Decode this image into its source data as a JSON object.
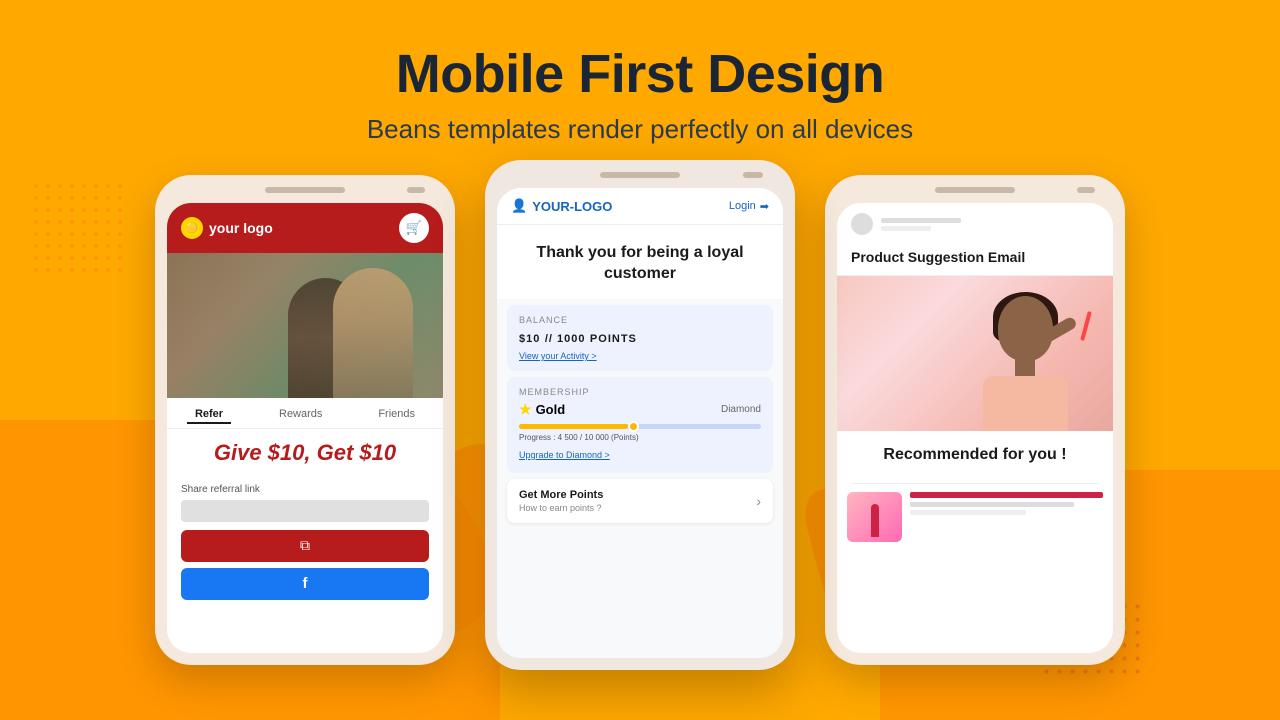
{
  "header": {
    "title": "Mobile First Design",
    "subtitle": "Beans templates render perfectly on all devices"
  },
  "phone1": {
    "logo_text": "your logo",
    "tabs": [
      "Refer",
      "Rewards",
      "Friends"
    ],
    "active_tab": "Refer",
    "offer_text": "Give $10, Get $10",
    "referral_label": "Share referral link",
    "copy_btn_icon": "copy-icon",
    "facebook_btn_icon": "facebook-icon"
  },
  "phone2": {
    "logo_text": "YOUR-LOGO",
    "login_text": "Login",
    "hero_text": "Thank you for being a loyal customer",
    "balance_label": "BALANCE",
    "balance_amount": "$10",
    "balance_points": "1000",
    "balance_unit": "POINTS",
    "view_activity": "View your Activity >",
    "membership_label": "MEMBERSHIP",
    "membership_tier": "Gold",
    "next_tier": "Diamond",
    "progress_text": "Progress : 4 500 / 10 000 (Points)",
    "upgrade_link": "Upgrade to Diamond >",
    "points_card_title": "Get More Points",
    "points_card_subtitle": "How to earn points ?"
  },
  "phone3": {
    "email_title": "Product Suggestion Email",
    "recommended_text": "Recommended for you !",
    "divider": true
  }
}
